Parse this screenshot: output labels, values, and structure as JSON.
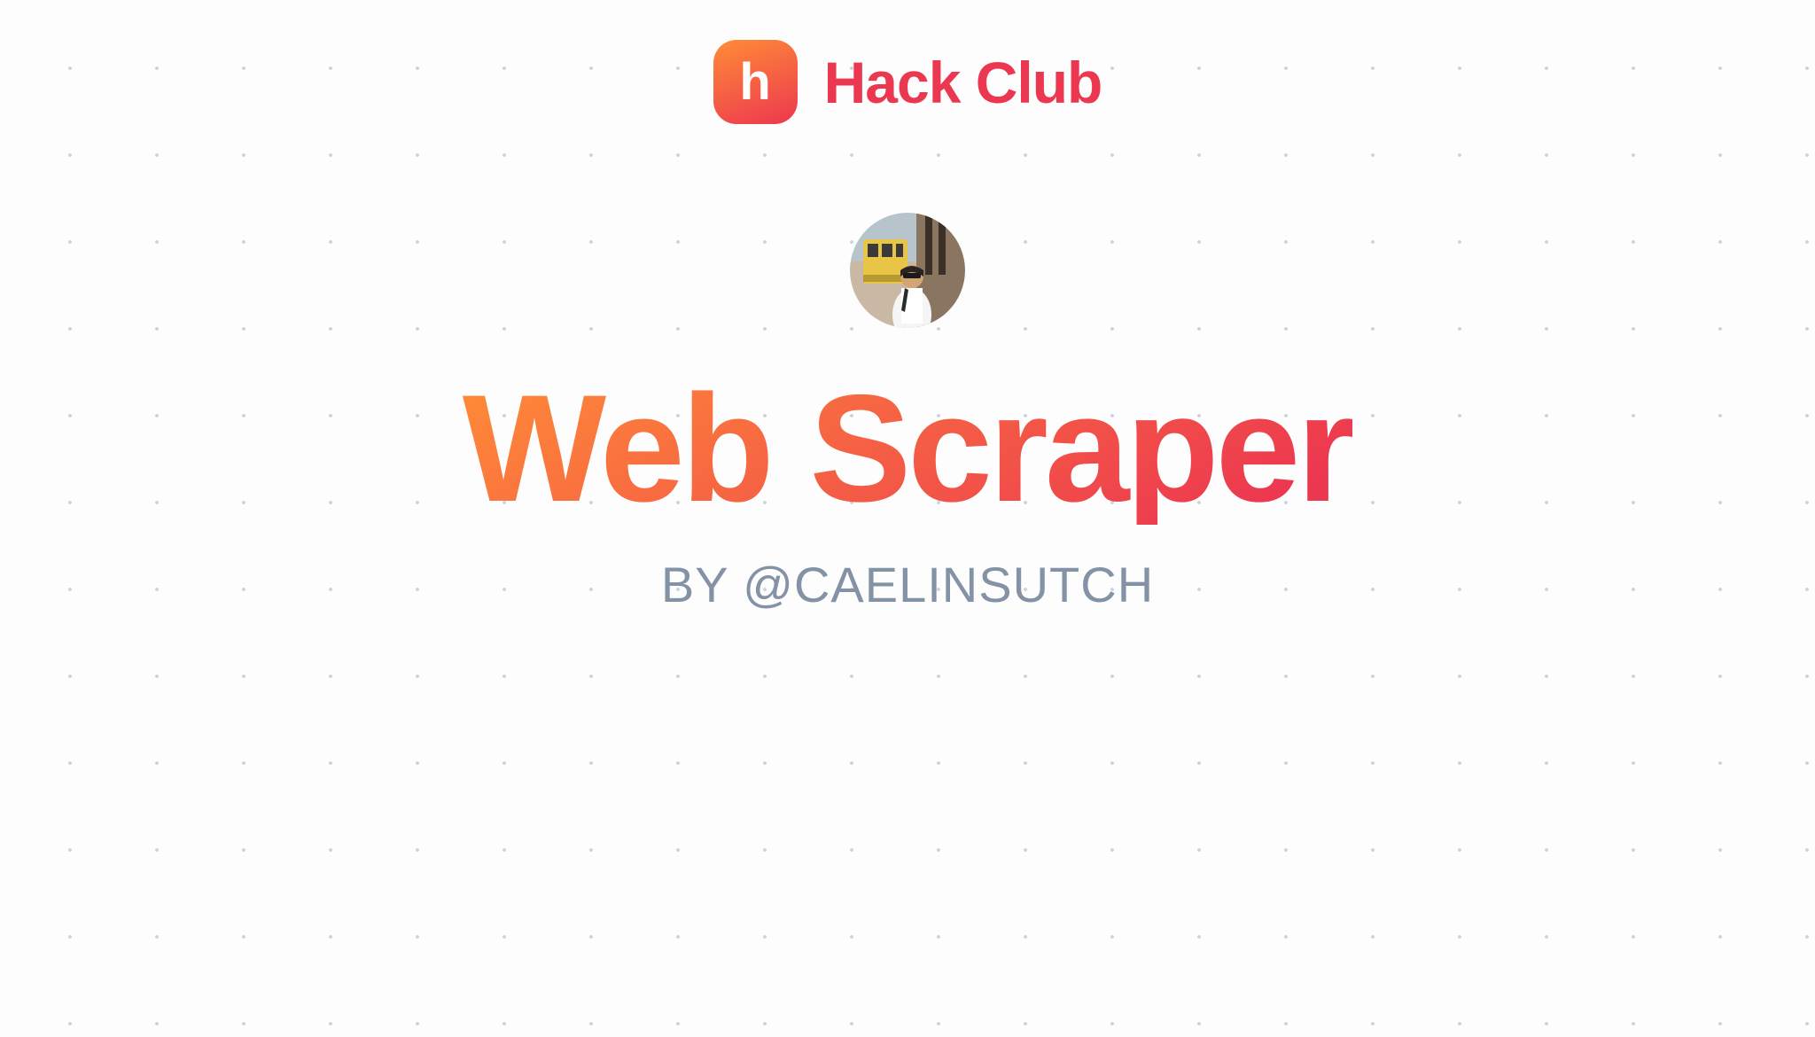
{
  "header": {
    "logo_letter": "h",
    "brand_name": "Hack Club"
  },
  "main": {
    "title": "Web Scraper",
    "byline": "BY @CAELINSUTCH"
  },
  "colors": {
    "gradient_start": "#ff8c37",
    "gradient_end": "#ec3750",
    "muted_text": "#8492a6"
  }
}
